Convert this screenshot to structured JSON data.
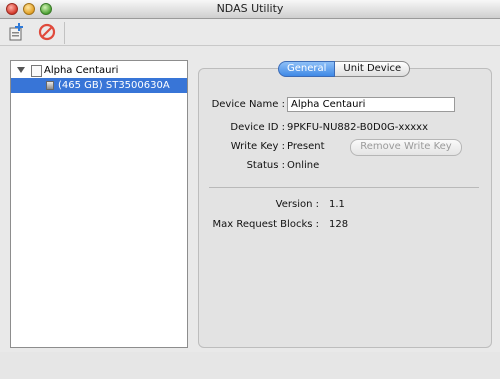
{
  "window": {
    "title": "NDAS Utility"
  },
  "toolbar": {
    "icons": [
      "register-device-icon",
      "unregister-icon"
    ]
  },
  "tree": {
    "host": "Alpha Centauri",
    "unit": "(465 GB) ST3500630A"
  },
  "tabs": {
    "general": "General",
    "unit_device": "Unit Device"
  },
  "general": {
    "device_name_label": "Device Name :",
    "device_name_value": "Alpha Centauri",
    "device_id_label": "Device ID :",
    "device_id_value": "9PKFU-NU882-B0D0G-xxxxx",
    "write_key_label": "Write Key :",
    "write_key_value": "Present",
    "remove_write_key_label": "Remove Write Key",
    "status_label": "Status :",
    "status_value": "Online",
    "version_label": "Version :",
    "version_value": "1.1",
    "max_request_label": "Max Request Blocks :",
    "max_request_value": "128"
  }
}
